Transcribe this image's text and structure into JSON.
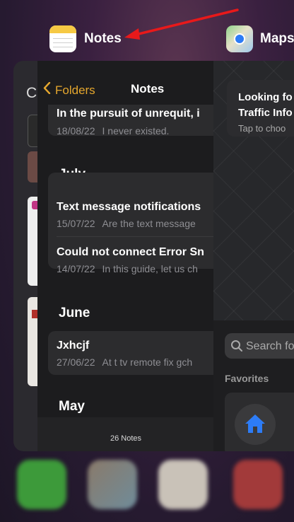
{
  "switcher": {
    "notes_app_label": "Notes",
    "maps_app_label": "Maps",
    "background_card_letter": "C"
  },
  "notes": {
    "back_label": "Folders",
    "title": "Notes",
    "top_note": {
      "title": "In the pursuit of unrequit, i",
      "date": "18/08/22",
      "preview": "I never existed."
    },
    "sections": [
      {
        "header": "July",
        "items": [
          {
            "title": "Text message notifications",
            "date": "15/07/22",
            "preview": "Are the text message"
          },
          {
            "title": "Could not connect Error Sn",
            "date": "14/07/22",
            "preview": "In this guide, let us ch"
          }
        ]
      },
      {
        "header": "June",
        "items": [
          {
            "title": "Jxhcjf",
            "date": "27/06/22",
            "preview": "At t tv remote fix gch"
          }
        ]
      },
      {
        "header": "May",
        "items": []
      }
    ],
    "count_label": "26 Notes"
  },
  "maps": {
    "banner_title_1": "Looking fo",
    "banner_title_2": "Traffic Info",
    "banner_sub": "Tap to choo",
    "search_placeholder": "Search fo",
    "favorites_heading": "Favorites"
  },
  "colors": {
    "accent": "#e5a72e",
    "annotation_arrow": "#e8191a",
    "maps_blue": "#2d7cf6"
  }
}
